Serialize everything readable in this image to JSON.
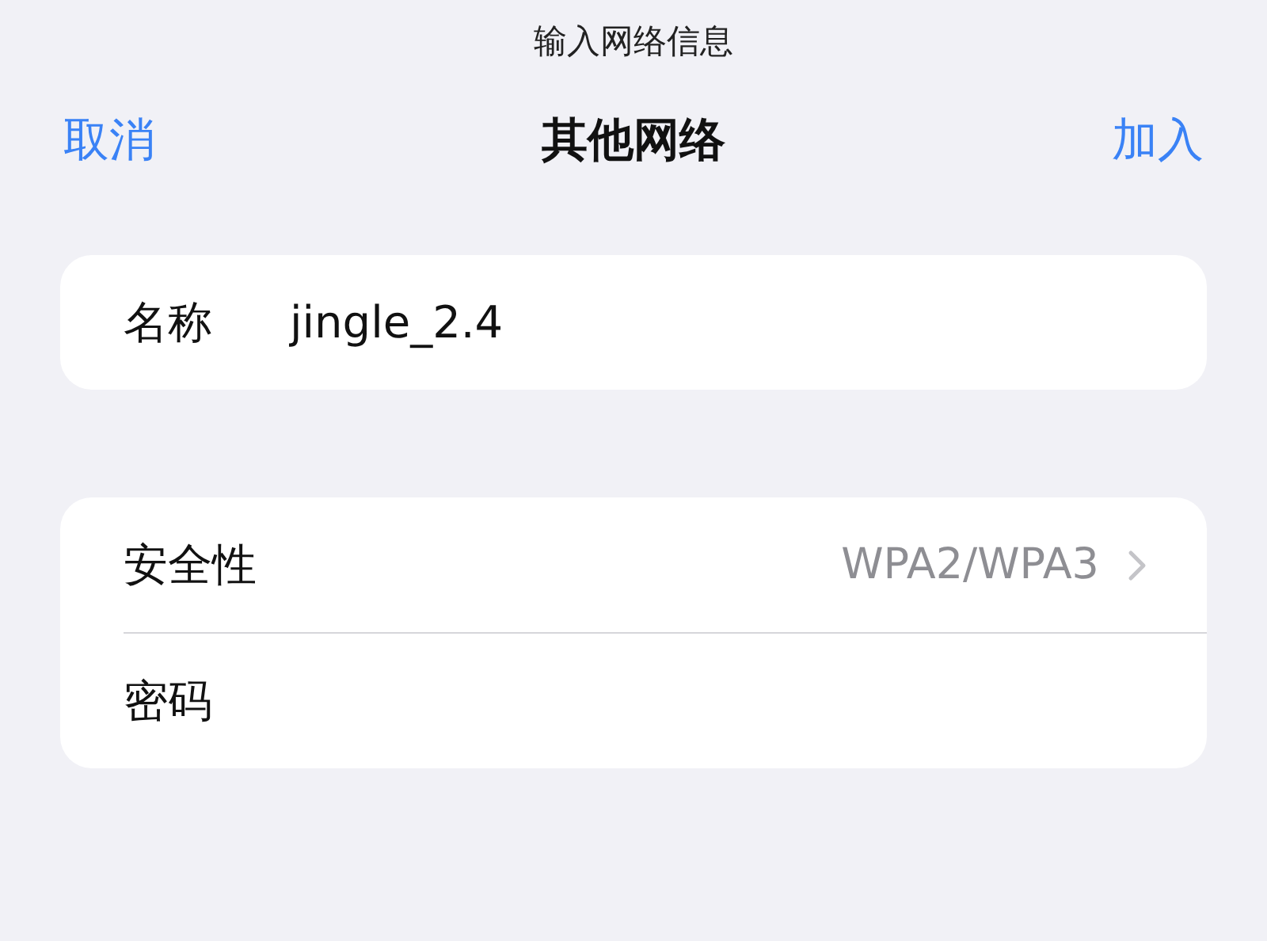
{
  "prompt": "输入网络信息",
  "nav": {
    "cancel": "取消",
    "title": "其他网络",
    "join": "加入"
  },
  "name_group": {
    "label": "名称",
    "value": "jingle_2.4"
  },
  "security_group": [
    {
      "kind": "select",
      "label": "安全性",
      "value": "WPA2/WPA3"
    },
    {
      "kind": "input",
      "label": "密码"
    }
  ]
}
